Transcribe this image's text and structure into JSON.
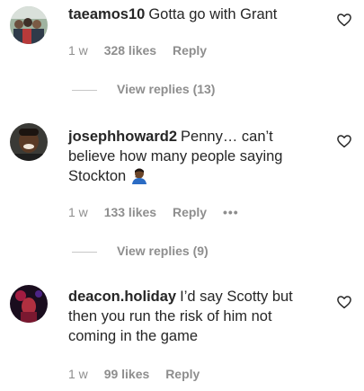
{
  "comments": [
    {
      "username": "taeamos10",
      "text": "Gotta go with Grant",
      "age": "1 w",
      "likes": "328 likes",
      "reply_label": "Reply",
      "view_replies": "View replies (13)"
    },
    {
      "username": "josephhoward2",
      "text": "Penny… can’t believe how many people saying Stockton",
      "emoji": "person-facepalming-icon",
      "age": "1 w",
      "likes": "133 likes",
      "reply_label": "Reply",
      "more_label": "•••",
      "view_replies": "View replies (9)"
    },
    {
      "username": "deacon.holiday",
      "text": "I’d say Scotty but then you run the risk of him not coming in the game",
      "age": "1 w",
      "likes": "99 likes",
      "reply_label": "Reply"
    }
  ],
  "colors": {
    "text": "#262626",
    "muted": "#8e8e8e",
    "divider": "#c7c7c7"
  },
  "icons": {
    "like": "heart-outline-icon"
  }
}
